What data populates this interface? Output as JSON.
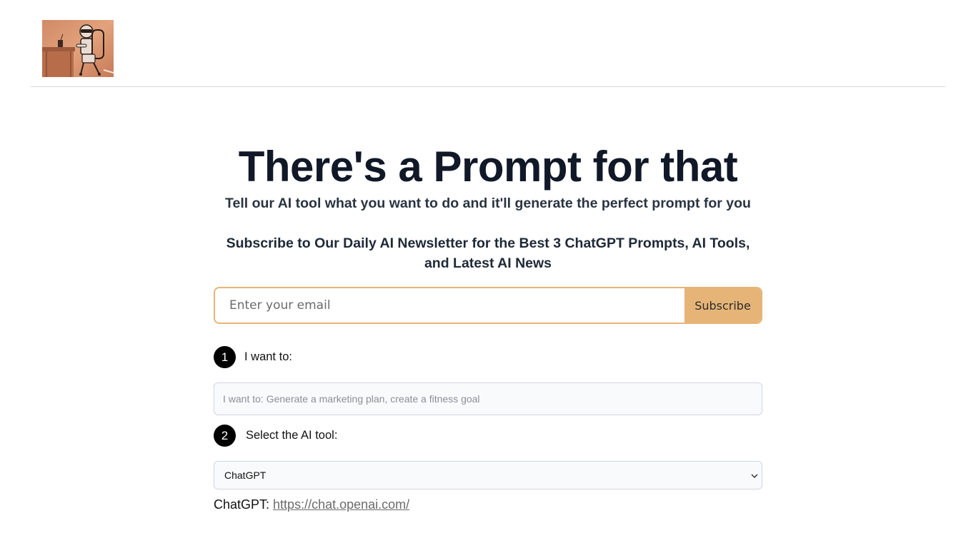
{
  "header": {
    "logo_icon": "robot-at-desk-logo"
  },
  "hero": {
    "title": "There's a Prompt for that",
    "subtitle": "Tell our AI tool what you want to do and it'll generate the perfect prompt for you"
  },
  "newsletter": {
    "heading": "Subscribe to Our Daily AI Newsletter for the Best 3 ChatGPT Prompts, AI Tools, and Latest AI News",
    "email_placeholder": "Enter your email",
    "email_value": "",
    "subscribe_label": "Subscribe",
    "accent_color": "#e6b477"
  },
  "steps": [
    {
      "number": "1",
      "label": "I want to:"
    },
    {
      "number": "2",
      "label": "Select the AI tool:"
    }
  ],
  "goal": {
    "placeholder": "I want to: Generate a marketing plan, create a fitness goal",
    "value": ""
  },
  "tool": {
    "selected": "ChatGPT",
    "chevron_icon": "chevron-down-icon",
    "link_label": "ChatGPT:",
    "link_url_text": "https://chat.openai.com/"
  }
}
